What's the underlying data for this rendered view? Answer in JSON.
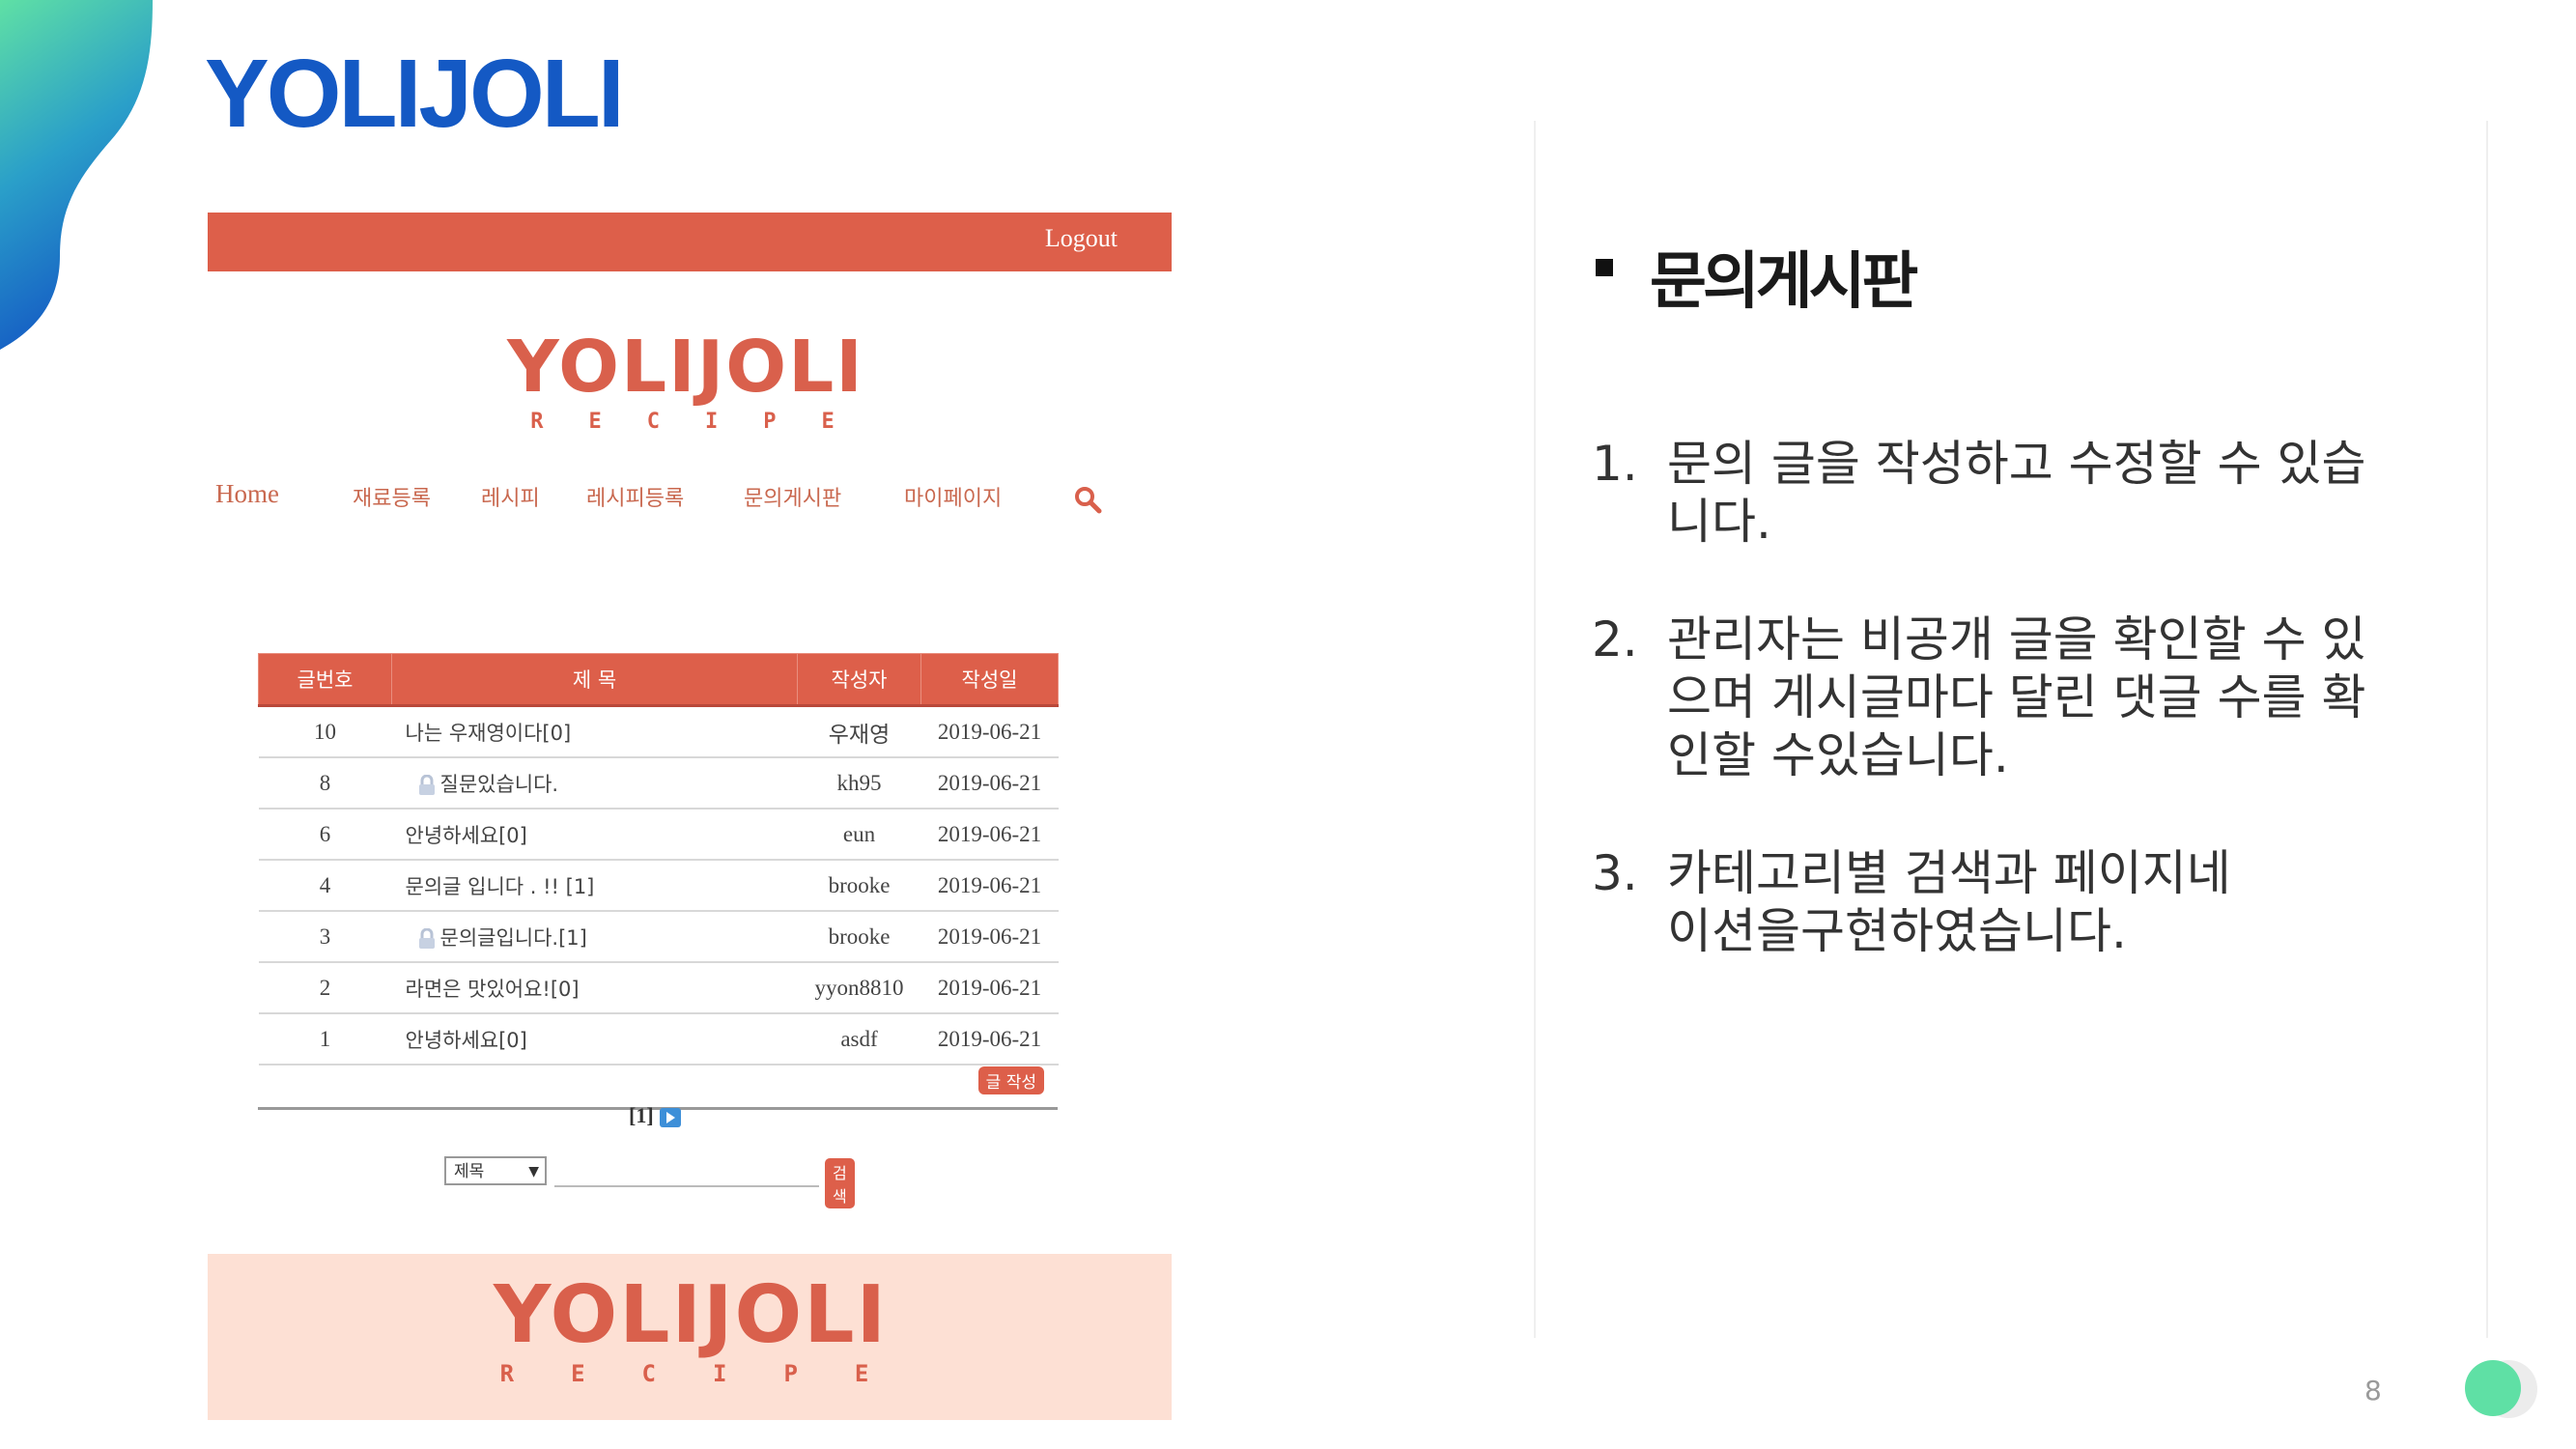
{
  "slide": {
    "title": "YOLIJOLI",
    "page_number": "8",
    "accent_color": "#1459c4"
  },
  "screenshot": {
    "logout_label": "Logout",
    "logo": {
      "word": "YOLIJOLI",
      "sub": "RECIPE",
      "color": "#d9604c"
    },
    "nav": {
      "home": "Home",
      "ingredients": "재료등록",
      "recipe": "레시피",
      "recipe_register": "레시피등록",
      "qna": "문의게시판",
      "mypage": "마이페이지",
      "search_icon": "search-icon"
    },
    "table": {
      "headers": [
        "글번호",
        "제 목",
        "작성자",
        "작성일"
      ],
      "rows": [
        {
          "num": "10",
          "title": "나는 우재영이다[0]",
          "author": "우재영",
          "date": "2019-06-21",
          "locked": false
        },
        {
          "num": "8",
          "title": "질문있습니다.",
          "author": "kh95",
          "date": "2019-06-21",
          "locked": true
        },
        {
          "num": "6",
          "title": "안녕하세요[0]",
          "author": "eun",
          "date": "2019-06-21",
          "locked": false
        },
        {
          "num": "4",
          "title": "문의글 입니다 . !! [1]",
          "author": "brooke",
          "date": "2019-06-21",
          "locked": false
        },
        {
          "num": "3",
          "title": "문의글입니다.[1]",
          "author": "brooke",
          "date": "2019-06-21",
          "locked": true
        },
        {
          "num": "2",
          "title": "라면은 맛있어요![0]",
          "author": "yyon8810",
          "date": "2019-06-21",
          "locked": false
        },
        {
          "num": "1",
          "title": "안녕하세요[0]",
          "author": "asdf",
          "date": "2019-06-21",
          "locked": false
        }
      ]
    },
    "write_button": "글 작성",
    "pager": "[1]",
    "search": {
      "select_value": "제목",
      "input_value": "",
      "button": "검색"
    },
    "primary_color": "#dd5f4a"
  },
  "content": {
    "heading": "문의게시판",
    "items": [
      {
        "n": "1.",
        "line1": "문의 글을 작성하고 수정할 수 있습",
        "line2": "니다.",
        "line3": ""
      },
      {
        "n": "2.",
        "line1": "관리자는 비공개 글을 확인할 수  있",
        "line2": "으며 게시글마다 달린 댓글 수를  확",
        "line3": "인할 수있습니다."
      },
      {
        "n": "3.",
        "line1": "카테고리별 검색과 페이지네",
        "line2": "이션을구현하였습니다.",
        "line3": ""
      }
    ]
  }
}
